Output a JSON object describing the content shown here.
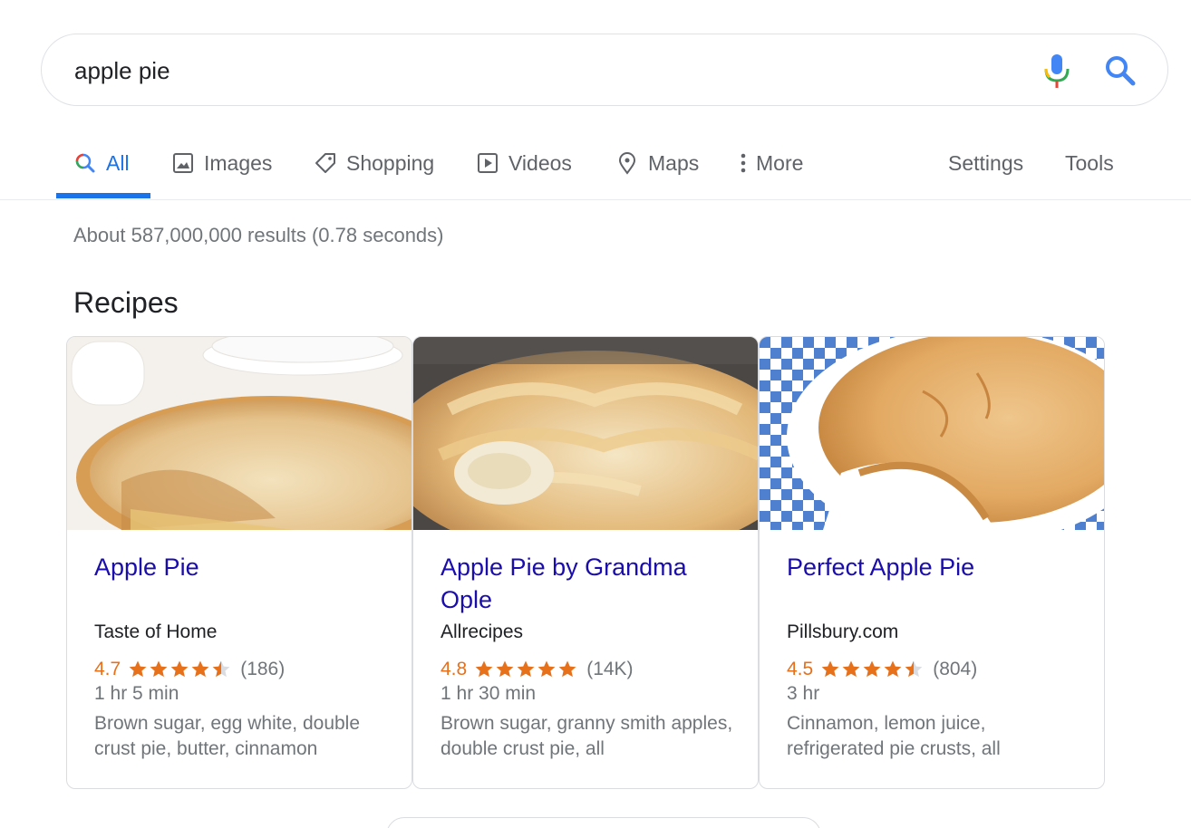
{
  "search": {
    "query": "apple pie"
  },
  "tabs": [
    {
      "label": "All",
      "icon": "search-icon",
      "active": true
    },
    {
      "label": "Images",
      "icon": "image-icon"
    },
    {
      "label": "Shopping",
      "icon": "tag-icon"
    },
    {
      "label": "Videos",
      "icon": "play-icon"
    },
    {
      "label": "Maps",
      "icon": "map-pin-icon"
    },
    {
      "label": "More",
      "icon": "more-vert-icon"
    },
    {
      "label": "Settings"
    },
    {
      "label": "Tools"
    }
  ],
  "result_stats": "About 587,000,000 results (0.78 seconds)",
  "section_title": "Recipes",
  "recipes": [
    {
      "title": "Apple Pie",
      "source": "Taste of Home",
      "rating": "4.7",
      "rating_value": 4.7,
      "reviews": "(186)",
      "time": "1 hr 5 min",
      "ingredients": "Brown sugar, egg white, double crust pie, butter, cinnamon"
    },
    {
      "title": "Apple Pie by Grandma Ople",
      "source": "Allrecipes",
      "rating": "4.8",
      "rating_value": 4.8,
      "reviews": "(14K)",
      "time": "1 hr 30 min",
      "ingredients": "Brown sugar, granny smith apples, double crust pie, all"
    },
    {
      "title": "Perfect Apple Pie",
      "source": "Pillsbury.com",
      "rating": "4.5",
      "rating_value": 4.5,
      "reviews": "(804)",
      "time": "3 hr",
      "ingredients": "Cinnamon, lemon juice, refrigerated pie crusts, all"
    }
  ],
  "colors": {
    "accent": "#1a73e8",
    "link": "#1a0dab",
    "rating": "#e7711b",
    "muted": "#70757a"
  }
}
